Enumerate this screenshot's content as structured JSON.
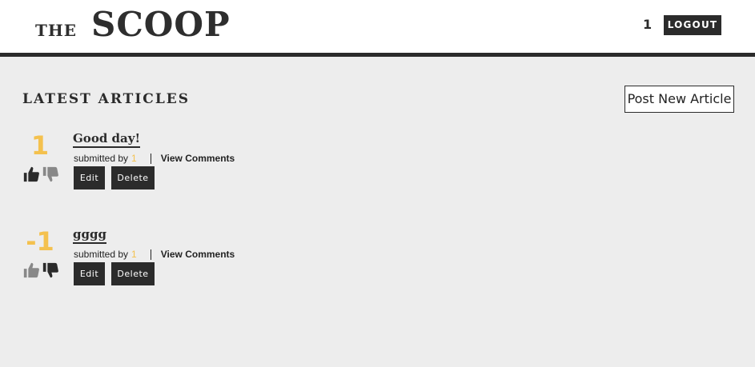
{
  "header": {
    "logo_the": "THE",
    "logo_scoop": "SCOOP",
    "user_number": "1",
    "logout_label": "LOGOUT"
  },
  "main": {
    "section_title": "LATEST ARTICLES",
    "post_button_label": "Post New Article"
  },
  "articles": [
    {
      "score": "1",
      "title": "Good day!",
      "submitted_by_label": "submitted by",
      "submitted_by_user": "1",
      "view_comments_label": "View Comments",
      "edit_label": "Edit",
      "delete_label": "Delete",
      "vote_state": "upvoted"
    },
    {
      "score": "-1",
      "title": "gggg",
      "submitted_by_label": "submitted by",
      "submitted_by_user": "1",
      "view_comments_label": "View Comments",
      "edit_label": "Edit",
      "delete_label": "Delete",
      "vote_state": "downvoted"
    }
  ],
  "colors": {
    "accent": "#f4c14e",
    "dark": "#2b2b2b",
    "background": "#ededed",
    "vote_active": "#2b2b2b",
    "vote_inactive": "#888888"
  },
  "icons": {
    "upvote": "thumbs-up-icon",
    "downvote": "thumbs-down-icon"
  }
}
